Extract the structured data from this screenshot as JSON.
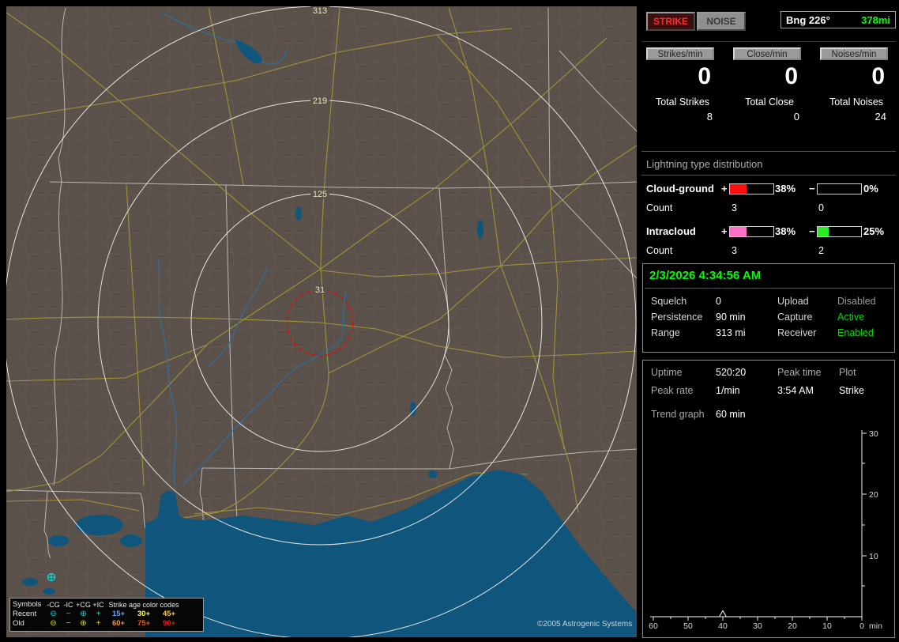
{
  "map": {
    "ring_labels": [
      "313",
      "219",
      "125",
      "31"
    ],
    "legend": {
      "symbols_header": "Symbols",
      "type_headers": [
        "-CG",
        "-IC",
        "+CG",
        "+IC"
      ],
      "age_header": "Strike age color codes",
      "rows": [
        {
          "label": "Recent",
          "symbol_color": "#00e0e0",
          "symbols": [
            "⊖",
            "−",
            "⊕",
            "+"
          ],
          "ages": [
            {
              "text": "15+",
              "color": "#5faaff"
            },
            {
              "text": "30+",
              "color": "#ffff55"
            },
            {
              "text": "45+",
              "color": "#ffcc33"
            }
          ]
        },
        {
          "label": "Old",
          "symbol_color": "#e0e000",
          "symbols": [
            "⊖",
            "−",
            "⊕",
            "+"
          ],
          "ages": [
            {
              "text": "60+",
              "color": "#ff9922"
            },
            {
              "text": "75+",
              "color": "#ff5511"
            },
            {
              "text": "90+",
              "color": "#ff1111"
            }
          ]
        }
      ]
    },
    "copyright": "©2005 Astrogenic Systems"
  },
  "sidebar": {
    "strike_button": "STRIKE",
    "noise_button": "NOISE",
    "bearing": {
      "label": "Bng 226°",
      "range": "378mi",
      "range_color": "#00ff00"
    },
    "counters": [
      {
        "label": "Strikes/min",
        "rate": "0",
        "total_label": "Total Strikes",
        "total": "8"
      },
      {
        "label": "Close/min",
        "rate": "0",
        "total_label": "Total Close",
        "total": "0"
      },
      {
        "label": "Noises/min",
        "rate": "0",
        "total_label": "Total Noises",
        "total": "24"
      }
    ],
    "distribution": {
      "title": "Lightning type distribution",
      "count_label": "Count",
      "rows": [
        {
          "name": "Cloud-ground",
          "plus_sign": "+",
          "plus_pct": "38%",
          "plus_fill": 38,
          "plus_color": "#ff1010",
          "minus_sign": "−",
          "minus_pct": "0%",
          "minus_fill": 0,
          "minus_color": "#ff1010",
          "plus_count": "3",
          "minus_count": "0"
        },
        {
          "name": "Intracloud",
          "plus_sign": "+",
          "plus_pct": "38%",
          "plus_fill": 38,
          "plus_color": "#ff6ec7",
          "minus_sign": "−",
          "minus_pct": "25%",
          "minus_fill": 25,
          "minus_color": "#22ee22",
          "plus_count": "3",
          "minus_count": "2"
        }
      ]
    },
    "clock": "2/3/2026 4:34:56 AM",
    "status_rows": [
      {
        "label": "Squelch",
        "value": "0",
        "label2": "Upload",
        "value2": "Disabled",
        "value2_color": "#9a9a9a"
      },
      {
        "label": "Persistence",
        "value": "90 min",
        "label2": "Capture",
        "value2": "Active",
        "value2_color": "#00dd00"
      },
      {
        "label": "Range",
        "value": "313 mi",
        "label2": "Receiver",
        "value2": "Enabled",
        "value2_color": "#00dd00"
      }
    ],
    "stats": {
      "uptime_label": "Uptime",
      "uptime_value": "520:20",
      "peak_time_label": "Peak time",
      "plot_label": "Plot",
      "peak_rate_label": "Peak rate",
      "peak_rate_value": "1/min",
      "peak_time_value": "3:54 AM",
      "plot_value": "Strike",
      "trend_label": "Trend graph",
      "trend_value": "60 min"
    }
  },
  "chart_data": {
    "type": "line",
    "title": "Strike rate trend graph (last 60 min)",
    "xlabel": "min",
    "x_unit": "min",
    "x_tick_labels": [
      "60",
      "50",
      "40",
      "30",
      "20",
      "10",
      "0"
    ],
    "y_tick_labels": [
      "30",
      "20",
      "10"
    ],
    "xlim": [
      60,
      0
    ],
    "ylim": [
      0,
      30
    ],
    "axis_side": "right",
    "grid": false,
    "series": [
      {
        "name": "Strike",
        "x": [
          60,
          55,
          50,
          45,
          42,
          41,
          40,
          39,
          38,
          35,
          30,
          25,
          20,
          15,
          10,
          5,
          0
        ],
        "values": [
          0,
          0,
          0,
          0,
          0,
          0,
          1,
          0,
          0,
          0,
          0,
          0,
          0,
          0,
          0,
          0,
          0
        ]
      }
    ],
    "annotations": {
      "peak_rate": "1/min",
      "peak_time": "3:54 AM"
    }
  }
}
